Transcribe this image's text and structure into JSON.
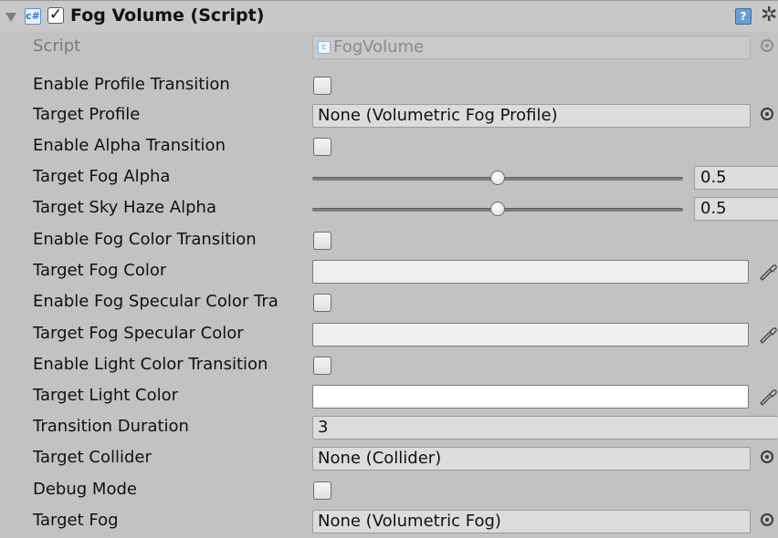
{
  "component": {
    "title": "Fog Volume (Script)",
    "enabled": true,
    "script_icon_glyph": "c#",
    "help_glyph": "?",
    "gear_glyph": "✲"
  },
  "script_row": {
    "label": "Script",
    "value": "FogVolume"
  },
  "enable_profile_transition": {
    "label": "Enable Profile Transition",
    "checked": false
  },
  "target_profile": {
    "label": "Target Profile",
    "value": "None (Volumetric Fog Profile)"
  },
  "enable_alpha_transition": {
    "label": "Enable Alpha Transition",
    "checked": false
  },
  "target_fog_alpha": {
    "label": "Target Fog Alpha",
    "value": "0.5",
    "fraction": 0.5
  },
  "target_sky_haze_alpha": {
    "label": "Target Sky Haze Alpha",
    "value": "0.5",
    "fraction": 0.5
  },
  "enable_fog_color_transition": {
    "label": "Enable Fog Color Transition",
    "checked": false
  },
  "target_fog_color": {
    "label": "Target Fog Color",
    "color": "#efefef"
  },
  "enable_fog_specular_color_transition": {
    "label": "Enable Fog Specular Color Tra",
    "checked": false
  },
  "target_fog_specular_color": {
    "label": "Target Fog Specular Color",
    "color": "#efefef"
  },
  "enable_light_color_transition": {
    "label": "Enable Light Color Transition",
    "checked": false
  },
  "target_light_color": {
    "label": "Target Light Color",
    "color": "#ffffff"
  },
  "transition_duration": {
    "label": "Transition Duration",
    "value": "3"
  },
  "target_collider": {
    "label": "Target Collider",
    "value": "None (Collider)"
  },
  "debug_mode": {
    "label": "Debug Mode",
    "checked": false
  },
  "target_fog": {
    "label": "Target Fog",
    "value": "None (Volumetric Fog)"
  }
}
